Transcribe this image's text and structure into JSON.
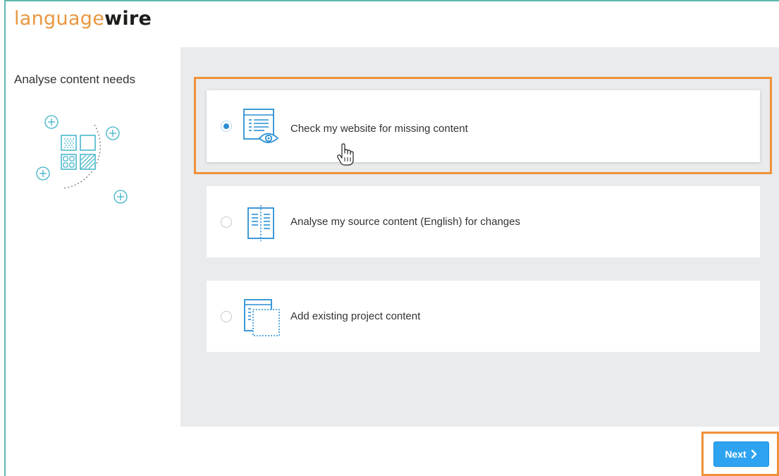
{
  "brand": {
    "logo_light": "language",
    "logo_bold": "wire",
    "light_color": "#e8973f",
    "bold_color": "#1d1d1b"
  },
  "sidebar": {
    "step_title": "Analyse content needs",
    "illustration_icon": "content-blocks-illustration"
  },
  "options": [
    {
      "label": "Check my website for missing content",
      "icon": "website-eye-icon",
      "selected": true
    },
    {
      "label": "Analyse my source content (English) for changes",
      "icon": "book-columns-icon",
      "selected": false
    },
    {
      "label": "Add existing project content",
      "icon": "add-project-icon",
      "selected": false
    }
  ],
  "footer": {
    "next_label": "Next",
    "next_icon": "chevron-right-icon"
  },
  "colors": {
    "accent_teal": "#5fb8ad",
    "icon_blue": "#2a8fd4",
    "button_blue": "#2ea3f2",
    "highlight_orange": "#f0913a",
    "panel_gray": "#e9ebec"
  }
}
